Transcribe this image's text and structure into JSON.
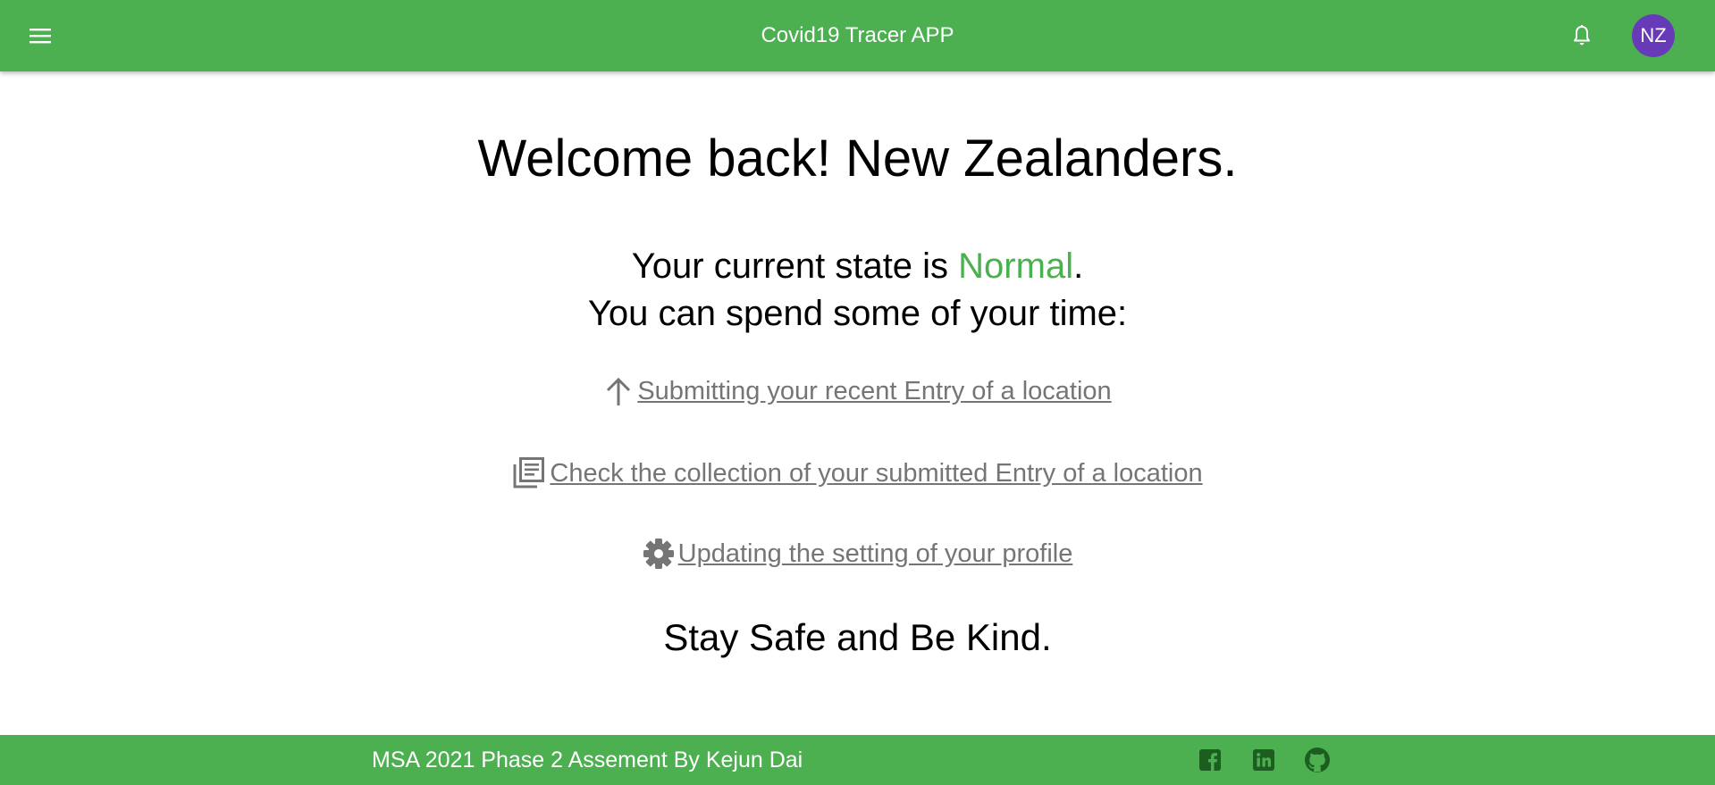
{
  "header": {
    "title": "Covid19 Tracer APP",
    "avatar_initials": "NZ",
    "menu_icon": "menu-icon",
    "notification_icon": "bell-icon"
  },
  "main": {
    "welcome": "Welcome back! New Zealanders.",
    "state_prefix": "Your current state is ",
    "state_value": "Normal",
    "state_suffix": ".",
    "spend_time": "You can spend some of your time:",
    "actions": [
      {
        "icon": "upload-arrow-icon",
        "label": "Submitting your recent Entry of a location"
      },
      {
        "icon": "library-books-icon",
        "label": "Check the collection of your submitted Entry of a location"
      },
      {
        "icon": "gear-icon",
        "label": "Updating the setting of your profile"
      }
    ],
    "closing": "Stay Safe and Be Kind."
  },
  "footer": {
    "text": "MSA 2021 Phase 2 Assement By Kejun Dai",
    "social_icons": [
      "facebook-icon",
      "linkedin-icon",
      "github-icon"
    ]
  },
  "colors": {
    "primary": "#4caf50",
    "avatar": "#673ab7",
    "link": "#757575",
    "footer_icon": "#1b5e20"
  }
}
